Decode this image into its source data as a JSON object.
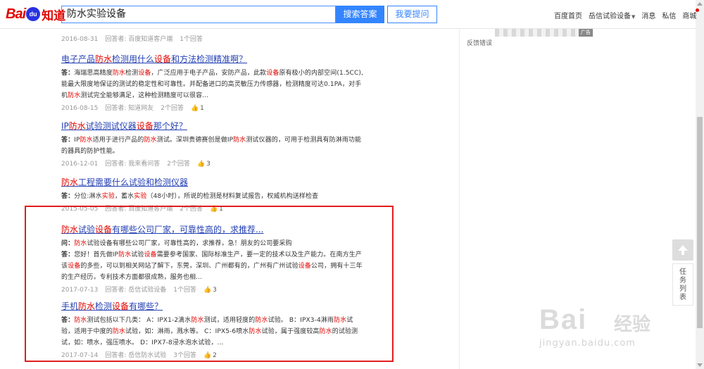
{
  "header": {
    "logo_bai": "Bai",
    "logo_du": "du",
    "logo_zhidao": "知道",
    "search_value": "防水实验设备",
    "search_button": "搜索答案",
    "ask_button": "我要提问",
    "nav": [
      "百度首页",
      "岳信试验设备",
      "消息",
      "私信",
      "商城"
    ]
  },
  "results": [
    {
      "title": [],
      "abstract": [],
      "date": "2016-08-31",
      "answerer": "回答者: 百度知道客户端",
      "answers": "1个回答",
      "likes": ""
    },
    {
      "title": [
        {
          "t": "电子产品"
        },
        {
          "t": "防水",
          "h": true
        },
        {
          "t": "检测用什么"
        },
        {
          "t": "设备",
          "h": true
        },
        {
          "t": "和方法检测精准啊？"
        }
      ],
      "abstract": [
        {
          "t": "答：",
          "b": true
        },
        {
          "t": "海瑞思高精度"
        },
        {
          "t": "防水",
          "h": true
        },
        {
          "t": "检测"
        },
        {
          "t": "设备",
          "h": true
        },
        {
          "t": "，广泛应用于电子产品，安防产品，此款"
        },
        {
          "t": "设备",
          "h": true
        },
        {
          "t": "原有极小的内部空间(1.5CC),能最大限度地保证的测试的稳定性和可靠性。并配备进口的高灵敏压力传感器，检测精度可达0.1PA，对手机"
        },
        {
          "t": "防水",
          "h": true
        },
        {
          "t": "测试完全能够满足，这种检测精度可以很容..."
        }
      ],
      "date": "2016-08-15",
      "answerer": "回答者: 知道网友",
      "answers": "2个回答",
      "likes": "1"
    },
    {
      "title": [
        {
          "t": "IP"
        },
        {
          "t": "防水",
          "h": true
        },
        {
          "t": "试验测试仪器"
        },
        {
          "t": "设备",
          "h": true
        },
        {
          "t": "那个好？"
        }
      ],
      "abstract": [
        {
          "t": "答：",
          "b": true
        },
        {
          "t": "IP"
        },
        {
          "t": "防水",
          "h": true
        },
        {
          "t": "适用于进行产品的"
        },
        {
          "t": "防水",
          "h": true
        },
        {
          "t": "测试。深圳贵德赛创是做IP"
        },
        {
          "t": "防水",
          "h": true
        },
        {
          "t": "测试仪器的，可用于检测具有防淋雨功能的器具的防护性能。"
        }
      ],
      "date": "2016-12-01",
      "answerer": "回答者: 我来看问答",
      "answers": "2个回答",
      "likes": "3"
    },
    {
      "title": [
        {
          "t": "防水",
          "h": true
        },
        {
          "t": "工程需要什么试验和检测仪器"
        }
      ],
      "abstract": [
        {
          "t": "答：",
          "b": true
        },
        {
          "t": "分位:淋水"
        },
        {
          "t": "实验",
          "h": true
        },
        {
          "t": "，蓄水"
        },
        {
          "t": "实验",
          "h": true
        },
        {
          "t": "（48小时），所说的检测是材料复试报告，权威机构送样检查"
        }
      ],
      "date": "2015-05-05",
      "answerer": "回答者: 百度知道客户端",
      "answers": "2个回答",
      "likes": "1"
    },
    {
      "title": [
        {
          "t": "防水",
          "h": true
        },
        {
          "t": "试验"
        },
        {
          "t": "设备",
          "h": true
        },
        {
          "t": "有哪些公司厂家，可靠性高的，求推荐..."
        }
      ],
      "question": [
        {
          "t": "问：",
          "b": true
        },
        {
          "t": "防水",
          "h": true
        },
        {
          "t": "试验设备有哪些公司厂家，可靠性高的，求推荐，急！朋友的公司要采购"
        }
      ],
      "abstract": [
        {
          "t": "答：",
          "b": true
        },
        {
          "t": "您好！首先做IP"
        },
        {
          "t": "防水",
          "h": true
        },
        {
          "t": "试验"
        },
        {
          "t": "设备",
          "h": true
        },
        {
          "t": "需要参考国家、国际标准生产，要一定的技术以及生产能力。在南方生产该"
        },
        {
          "t": "设备",
          "h": true
        },
        {
          "t": "的多些，可以到相关网站了解下，东莞，深圳、广州都有的，广州有广州试验"
        },
        {
          "t": "设备",
          "h": true
        },
        {
          "t": "公司，拥有十三年的生产经历，专利技术方面都很成熟，服务也相..."
        }
      ],
      "date": "2017-07-13",
      "answerer": "回答者: 岳信试验设备",
      "answers": "1个回答",
      "likes": "3"
    },
    {
      "title": [
        {
          "t": "手机"
        },
        {
          "t": "防水",
          "h": true
        },
        {
          "t": "检测"
        },
        {
          "t": "设备",
          "h": true
        },
        {
          "t": "有哪些？"
        }
      ],
      "abstract": [
        {
          "t": "答：",
          "b": true
        },
        {
          "t": "防水",
          "h": true
        },
        {
          "t": "测试包括以下几类： A：IPX1-2滴水"
        },
        {
          "t": "防水",
          "h": true
        },
        {
          "t": "测试，适用轻度的"
        },
        {
          "t": "防水",
          "h": true
        },
        {
          "t": "试验。 B：IPX3-4淋雨"
        },
        {
          "t": "防水",
          "h": true
        },
        {
          "t": "试验，适用于中度的"
        },
        {
          "t": "防水",
          "h": true
        },
        {
          "t": "试验，如：淋雨，溅水等。 C：IPX5-6喷水"
        },
        {
          "t": "防水",
          "h": true
        },
        {
          "t": "试验，属于强度较高"
        },
        {
          "t": "防水",
          "h": true
        },
        {
          "t": "的试验测试，如：喷水，强压喷水。 D：IPX7-8浸水泡水试验，..."
        }
      ],
      "date": "2017-07-14",
      "answerer": "回答者: 岳信防水试验",
      "answers": "3个回答",
      "likes": "2"
    }
  ],
  "sidebar": {
    "ad_tag": "广告",
    "feedback": "反馈错误"
  },
  "float": {
    "task_list": "任务列表"
  },
  "watermark": {
    "main": "Bai",
    "cn": "经验",
    "url": "jingyan.baidu.com"
  },
  "colors": {
    "link": "#2440b3",
    "highlight": "#e10601",
    "primary": "#3385ff",
    "box": "#e31d1d"
  }
}
